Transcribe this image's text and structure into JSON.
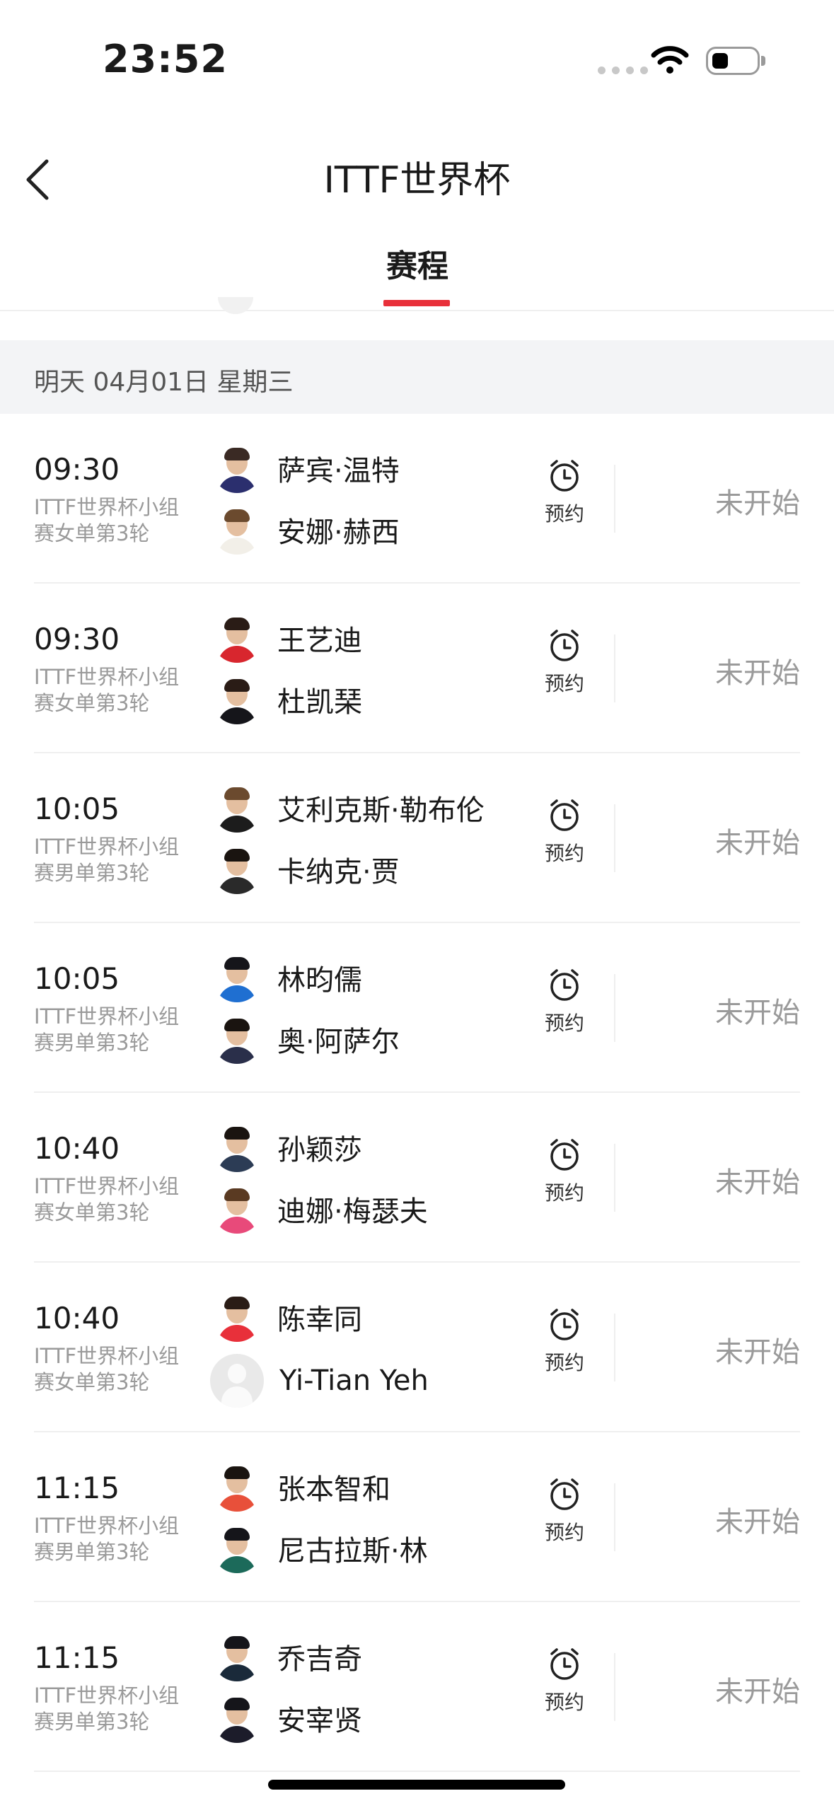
{
  "status_bar": {
    "time": "23:52"
  },
  "nav": {
    "title": "ITTF世界杯"
  },
  "tabs": [
    {
      "label": "赛程",
      "active": true
    }
  ],
  "accent_color": "#e8303a",
  "date_header": "明天  04月01日  星期三",
  "matches": [
    {
      "time": "09:30",
      "event": "ITTF世界杯小组赛女单第3轮",
      "player1": "萨宾·温特",
      "player2": "安娜·赫西",
      "reserve": "预约",
      "status": "未开始"
    },
    {
      "time": "09:30",
      "event": "ITTF世界杯小组赛女单第3轮",
      "player1": "王艺迪",
      "player2": "杜凯琹",
      "reserve": "预约",
      "status": "未开始"
    },
    {
      "time": "10:05",
      "event": "ITTF世界杯小组赛男单第3轮",
      "player1": "艾利克斯·勒布伦",
      "player2": "卡纳克·贾",
      "reserve": "预约",
      "status": "未开始"
    },
    {
      "time": "10:05",
      "event": "ITTF世界杯小组赛男单第3轮",
      "player1": "林昀儒",
      "player2": "奥·阿萨尔",
      "reserve": "预约",
      "status": "未开始"
    },
    {
      "time": "10:40",
      "event": "ITTF世界杯小组赛女单第3轮",
      "player1": "孙颖莎",
      "player2": "迪娜·梅瑟夫",
      "reserve": "预约",
      "status": "未开始"
    },
    {
      "time": "10:40",
      "event": "ITTF世界杯小组赛女单第3轮",
      "player1": "陈幸同",
      "player2": "Yi-Tian Yeh",
      "reserve": "预约",
      "status": "未开始"
    },
    {
      "time": "11:15",
      "event": "ITTF世界杯小组赛男单第3轮",
      "player1": "张本智和",
      "player2": "尼古拉斯·林",
      "reserve": "预约",
      "status": "未开始"
    },
    {
      "time": "11:15",
      "event": "ITTF世界杯小组赛男单第3轮",
      "player1": "乔吉奇",
      "player2": "安宰贤",
      "reserve": "预约",
      "status": "未开始"
    }
  ]
}
